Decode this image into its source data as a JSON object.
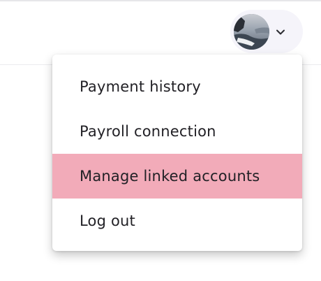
{
  "header": {
    "account_avatar_icon": "user-avatar-photo",
    "dropdown_icon": "chevron-down-icon"
  },
  "menu": {
    "items": [
      {
        "label": "Payment history"
      },
      {
        "label": "Payroll connection"
      },
      {
        "label": "Manage linked accounts",
        "highlighted": true
      },
      {
        "label": "Log out"
      }
    ]
  },
  "colors": {
    "highlight": "#f2abb9",
    "account_button_bg": "#f5f4fa",
    "text": "#222126"
  }
}
